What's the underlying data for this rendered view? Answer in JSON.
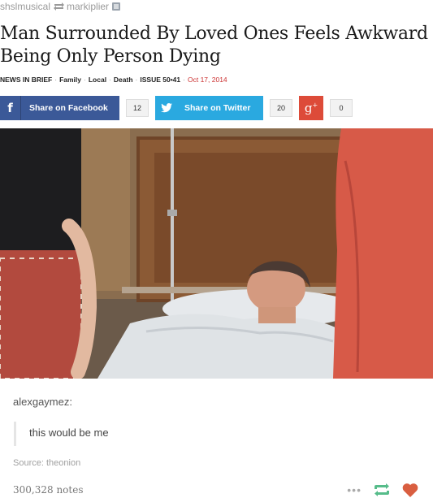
{
  "reblog": {
    "from_user": "shslmusical",
    "to_user": "markiplier"
  },
  "article": {
    "headline": "Man Surrounded By Loved Ones Feels Awkward Being Only Person Dying",
    "meta": {
      "section": "NEWS IN BRIEF",
      "tags": [
        "Family",
        "Local",
        "Death",
        "ISSUE 50•41"
      ],
      "date": "Oct 17, 2014"
    },
    "share": {
      "facebook_label": "Share on Facebook",
      "facebook_count": "12",
      "twitter_label": "Share on Twitter",
      "twitter_count": "20",
      "googleplus_count": "0"
    },
    "photo_description_icon": "hospital-bed-photo"
  },
  "post": {
    "op_username": "alexgaymez:",
    "quote": "this would be me",
    "source_label": "Source:",
    "source_link": "theonion",
    "notes": "300,328 notes"
  },
  "colors": {
    "facebook": "#3b5998",
    "twitter": "#2aa9e0",
    "googleplus": "#dd4b39",
    "reblog_green": "#56bc8a",
    "like_red": "#d95e40"
  }
}
